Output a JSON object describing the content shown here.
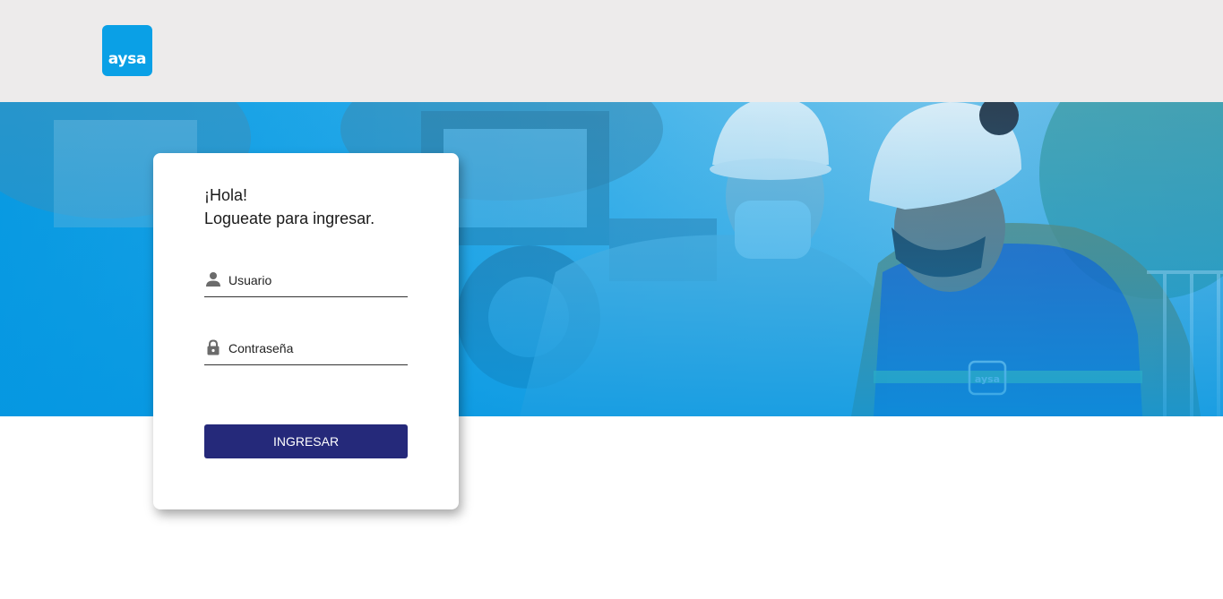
{
  "header": {
    "logo_text": "aysa"
  },
  "hero": {
    "badge_text": "aysa"
  },
  "login": {
    "greeting_line1": "¡Hola!",
    "greeting_line2": "Logueate para ingresar.",
    "username_placeholder": "Usuario",
    "username_icon": "person-icon",
    "password_placeholder": "Contraseña",
    "password_icon": "lock-icon",
    "submit_label": "INGRESAR"
  },
  "colors": {
    "topbar": "#edebeb",
    "brand_blue": "#0aa0e6",
    "button": "#25297a"
  }
}
